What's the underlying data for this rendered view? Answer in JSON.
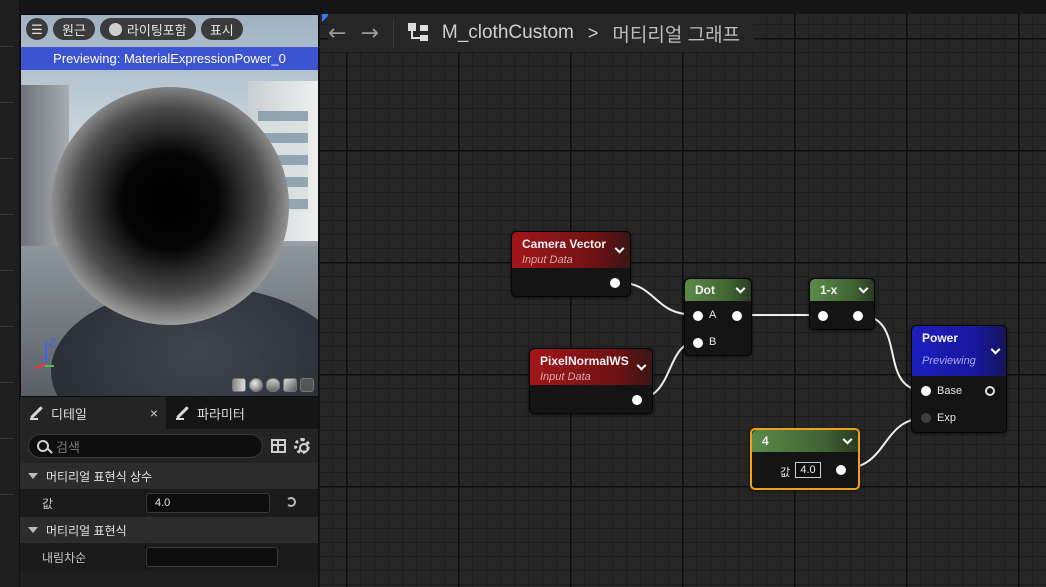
{
  "viewport": {
    "menu_icon": "hamburger-icon",
    "perspective_label": "원근",
    "lighting_label": "라이팅포함",
    "show_label": "표시",
    "banner": "Previewing: MaterialExpressionPower_0",
    "axis_label": "Z"
  },
  "details": {
    "tab_details": "디테일",
    "tab_params": "파라미터",
    "close_glyph": "×",
    "search_placeholder": "검색",
    "section1": "머티리얼 표현식 상수",
    "prop_value_label": "값",
    "prop_value": "4.0",
    "section2": "머티리얼 표현식",
    "prop_desc_label": "내림차순",
    "prop_desc_value": ""
  },
  "breadcrumb": {
    "asset": "M_clothCustom",
    "separator": ">",
    "page": "머티리얼 그래프"
  },
  "nodes": {
    "camera": {
      "title": "Camera Vector",
      "subtitle": "Input Data"
    },
    "pixel": {
      "title": "PixelNormalWS",
      "subtitle": "Input Data"
    },
    "dot": {
      "title": "Dot",
      "pin_a": "A",
      "pin_b": "B"
    },
    "oneminus": {
      "title": "1-x"
    },
    "power": {
      "title": "Power",
      "subtitle": "Previewing",
      "pin_base": "Base",
      "pin_exp": "Exp"
    },
    "const": {
      "title": "4",
      "value_label": "값",
      "value": "4.0"
    }
  },
  "colors": {
    "banner": "#3c54d1",
    "input_node": "#a3161b",
    "math_node": "#5c8a4b",
    "power_node": "#1c1fbf",
    "selection": "#f0a11a"
  }
}
